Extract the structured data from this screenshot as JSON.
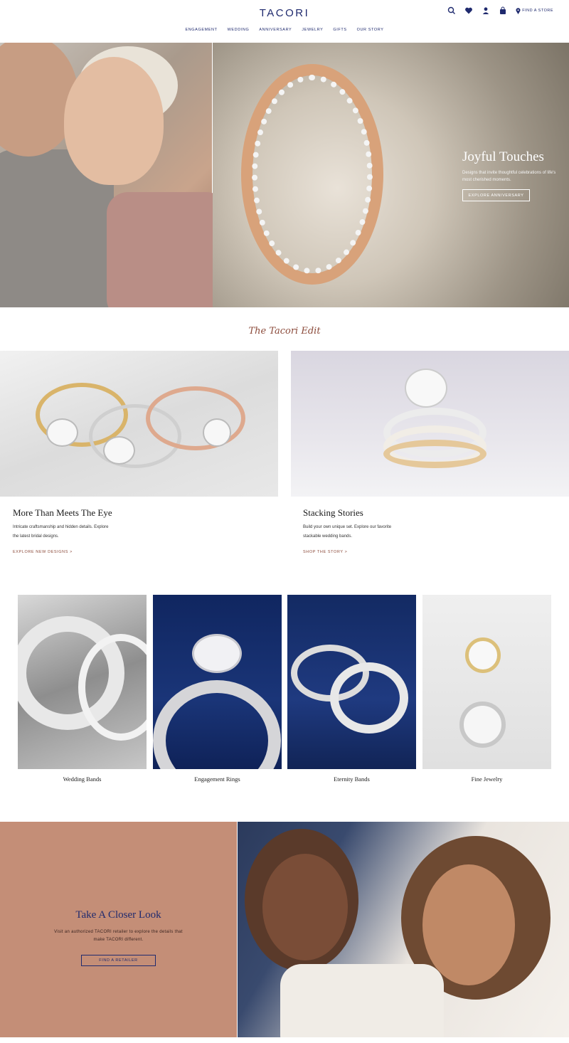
{
  "header": {
    "logo": "TACORI",
    "find_store": "FIND A STORE",
    "nav": [
      "ENGAGEMENT",
      "WEDDING",
      "ANNIVERSARY",
      "JEWELRY",
      "GIFTS",
      "OUR STORY"
    ],
    "icons": [
      "search-icon",
      "heart-icon",
      "account-icon",
      "bag-icon",
      "location-pin-icon"
    ]
  },
  "hero": {
    "title": "Joyful Touches",
    "subtitle": "Designs that invite thoughtful celebrations of life's most cherished moments.",
    "button": "EXPLORE ANNIVERSARY"
  },
  "edit": {
    "title": "The Tacori Edit",
    "cards": [
      {
        "title": "More Than Meets The Eye",
        "desc": "Intricate craftsmanship and hidden details. Explore the latest bridal designs.",
        "link": "EXPLORE NEW DESIGNS >"
      },
      {
        "title": "Stacking Stories",
        "desc": "Build your own unique set. Explore our favorite stackable wedding bands.",
        "link": "SHOP THE STORY >"
      }
    ]
  },
  "categories": [
    "Wedding Bands",
    "Engagement Rings",
    "Eternity Bands",
    "Fine Jewelry"
  ],
  "closer": {
    "title": "Take A Closer Look",
    "desc": "Visit an authorized TACORI retailer to explore the details that make TACORI different.",
    "button": "FIND A RETAILER"
  },
  "colors": {
    "brand_navy": "#1f2a6e",
    "accent_rust": "#8b4a3a",
    "closer_bg": "#c48e77"
  }
}
